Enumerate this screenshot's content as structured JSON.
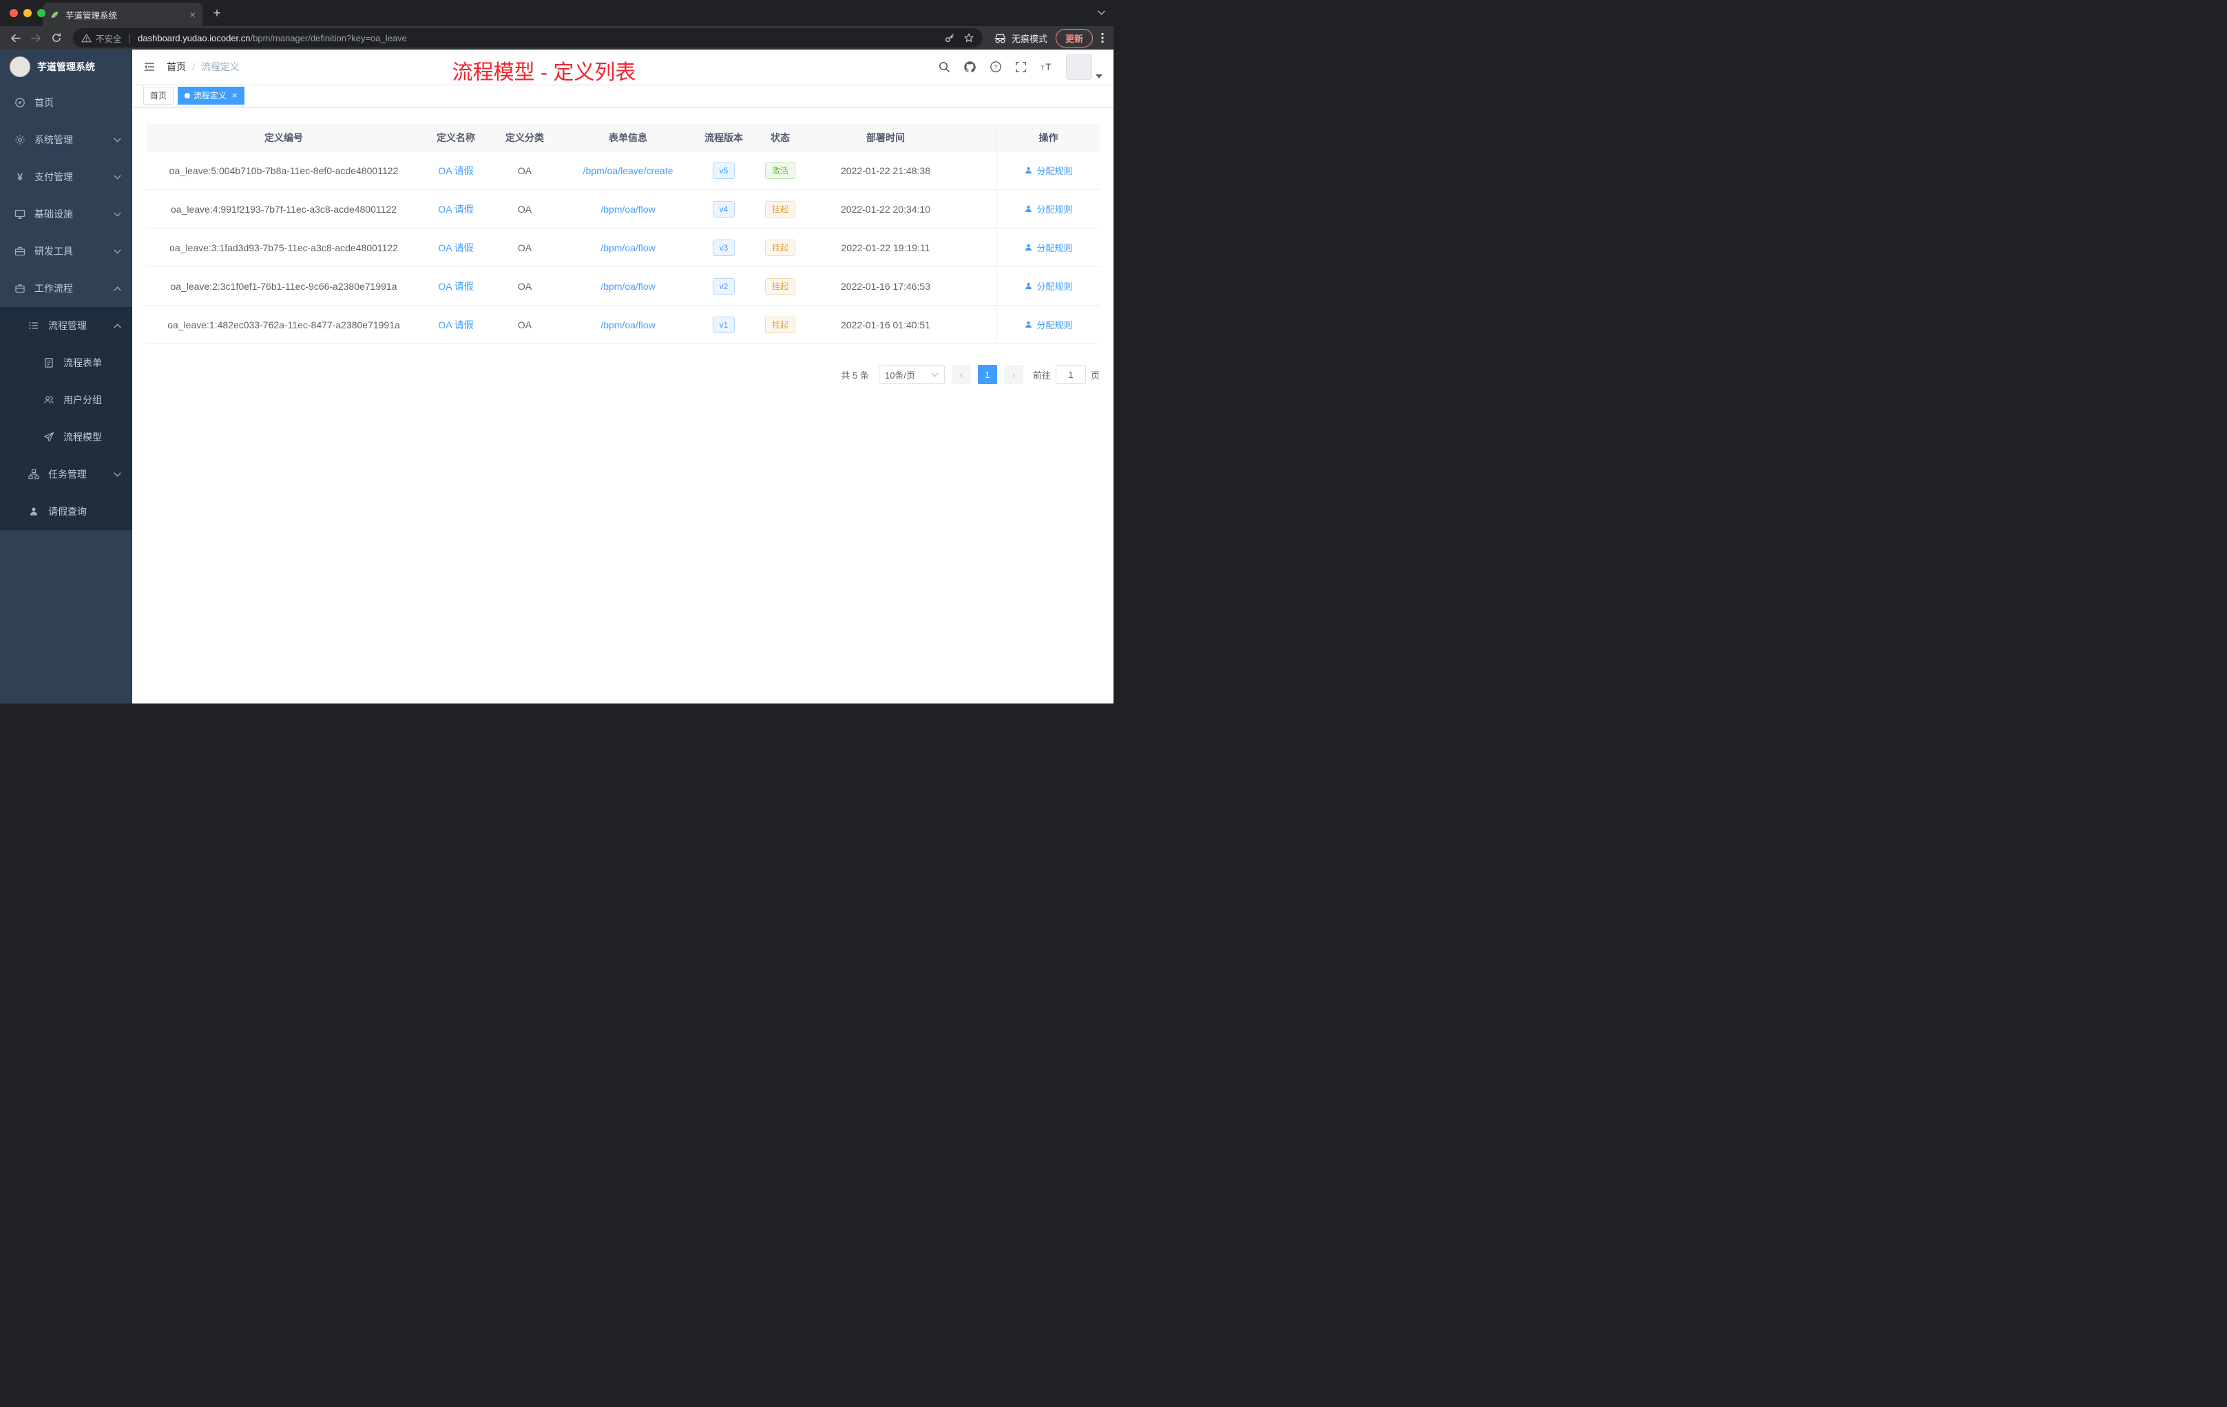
{
  "browser": {
    "tab_title": "芋道管理系统",
    "new_tab_glyph": "+",
    "close_glyph": "×",
    "security_label": "不安全",
    "url_host": "dashboard.yudao.iocoder.cn",
    "url_path": "/bpm/manager/definition?key=oa_leave",
    "incognito_label": "无痕模式",
    "update_label": "更新"
  },
  "icons": {
    "tab_favicon": "leaf",
    "security": "warning-triangle",
    "omnibox_end": [
      "key",
      "star"
    ],
    "profile": "incognito-glasses",
    "menu": "kebab-dots",
    "navbar_right": [
      "magnifier",
      "github-cat",
      "question-circle",
      "fullscreen-expand",
      "font-size"
    ],
    "action_cell": "user-silhouette"
  },
  "sidebar": {
    "logo_title": "芋道管理系统",
    "items": [
      {
        "label": "首页",
        "icon": "dashboard-icon",
        "level": 1
      },
      {
        "label": "系统管理",
        "icon": "gear-icon",
        "level": 1,
        "chevron": "down"
      },
      {
        "label": "支付管理",
        "icon": "yen-icon",
        "level": 1,
        "chevron": "down"
      },
      {
        "label": "基础设施",
        "icon": "monitor-icon",
        "level": 1,
        "chevron": "down"
      },
      {
        "label": "研发工具",
        "icon": "toolbox-icon",
        "level": 1,
        "chevron": "down"
      },
      {
        "label": "工作流程",
        "icon": "briefcase-icon",
        "level": 1,
        "chevron": "up"
      },
      {
        "label": "流程管理",
        "icon": "list-icon",
        "level": 2,
        "chevron": "up"
      },
      {
        "label": "流程表单",
        "icon": "form-icon",
        "level": 3
      },
      {
        "label": "用户分组",
        "icon": "users-icon",
        "level": 3
      },
      {
        "label": "流程模型",
        "icon": "send-icon",
        "level": 3
      },
      {
        "label": "任务管理",
        "icon": "tasks-icon",
        "level": 2,
        "chevron": "down"
      },
      {
        "label": "请假查询",
        "icon": "user-icon",
        "level": 2
      }
    ]
  },
  "navbar": {
    "breadcrumb_home": "首页",
    "breadcrumb_separator": "/",
    "breadcrumb_current": "流程定义",
    "annotation": "流程模型 - 定义列表",
    "annotation_color": "#f5222d"
  },
  "tags": {
    "home": "首页",
    "current": "流程定义",
    "close_glyph": "×"
  },
  "table": {
    "columns": [
      "定义编号",
      "定义名称",
      "定义分类",
      "表单信息",
      "流程版本",
      "状态",
      "部署时间",
      "操作"
    ],
    "rows": [
      {
        "id": "oa_leave:5:004b710b-7b8a-11ec-8ef0-acde48001122",
        "name": "OA 请假",
        "category": "OA",
        "form": "/bpm/oa/leave/create",
        "version": "v5",
        "status": "激活",
        "status_class": "badge-success",
        "time": "2022-01-22 21:48:38",
        "action": "分配规则"
      },
      {
        "id": "oa_leave:4:991f2193-7b7f-11ec-a3c8-acde48001122",
        "name": "OA 请假",
        "category": "OA",
        "form": "/bpm/oa/flow",
        "version": "v4",
        "status": "挂起",
        "status_class": "badge-warning",
        "time": "2022-01-22 20:34:10",
        "action": "分配规则"
      },
      {
        "id": "oa_leave:3:1fad3d93-7b75-11ec-a3c8-acde48001122",
        "name": "OA 请假",
        "category": "OA",
        "form": "/bpm/oa/flow",
        "version": "v3",
        "status": "挂起",
        "status_class": "badge-warning",
        "time": "2022-01-22 19:19:11",
        "action": "分配规则"
      },
      {
        "id": "oa_leave:2:3c1f0ef1-76b1-11ec-9c66-a2380e71991a",
        "name": "OA 请假",
        "category": "OA",
        "form": "/bpm/oa/flow",
        "version": "v2",
        "status": "挂起",
        "status_class": "badge-warning",
        "time": "2022-01-16 17:46:53",
        "action": "分配规则"
      },
      {
        "id": "oa_leave:1:482ec033-762a-11ec-8477-a2380e71991a",
        "name": "OA 请假",
        "category": "OA",
        "form": "/bpm/oa/flow",
        "version": "v1",
        "status": "挂起",
        "status_class": "badge-warning",
        "time": "2022-01-16 01:40:51",
        "action": "分配规则"
      }
    ]
  },
  "pagination": {
    "total": "共 5 条",
    "page_size": "10条/页",
    "prev_glyph": "‹",
    "current_page": "1",
    "next_glyph": "›",
    "goto_label": "前往",
    "goto_value": "1",
    "page_unit": "页"
  },
  "colors": {
    "accent": "#409eff",
    "sidebar_bg": "#304156",
    "submenu_bg": "#1f2d3d",
    "success": "#67c23a",
    "warning": "#e6a23c",
    "annotation_red": "#f5222d"
  }
}
